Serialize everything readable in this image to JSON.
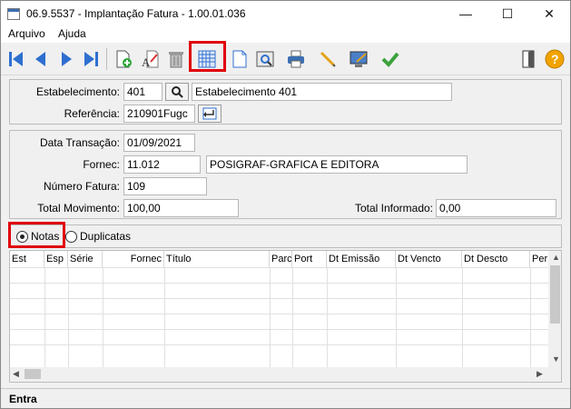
{
  "window": {
    "title": "06.9.5537 - Implantação Fatura - 1.00.01.036",
    "controls": {
      "minimize": "—",
      "maximize": "☐",
      "close": "✕"
    }
  },
  "menu": {
    "items": [
      "Arquivo",
      "Ajuda"
    ]
  },
  "toolbar": {
    "buttons": [
      "first-icon",
      "previous-icon",
      "next-icon",
      "last-icon",
      "new-icon",
      "edit-icon",
      "delete-icon",
      "calendar-grid-icon",
      "document-icon",
      "preview-icon",
      "print-icon",
      "pencil-icon",
      "tools-icon",
      "confirm-icon",
      "exit-icon",
      "help-icon"
    ],
    "highlight_color": "#e0000a"
  },
  "header_panel": {
    "estabelecimento_label": "Estabelecimento:",
    "estabelecimento_code": "401",
    "estabelecimento_name": "Estabelecimento 401",
    "referencia_label": "Referência:",
    "referencia_value": "210901Fugc"
  },
  "detail_panel": {
    "data_transacao_label": "Data Transação:",
    "data_transacao_value": "01/09/2021",
    "fornec_label": "Fornec:",
    "fornec_code": "11.012",
    "fornec_name": "POSIGRAF-GRAFICA E EDITORA",
    "numero_fatura_label": "Número  Fatura:",
    "numero_fatura_value": "109",
    "total_movimento_label": "Total  Movimento:",
    "total_movimento_value": "100,00",
    "total_informado_label": "Total Informado:",
    "total_informado_value": "0,00"
  },
  "options": {
    "notas_label": "Notas",
    "duplicatas_label": "Duplicatas",
    "selected": "Notas"
  },
  "grid": {
    "columns": [
      "Est",
      "Esp",
      "Série",
      "Fornec",
      "Título",
      "Parc",
      "Port",
      "Dt Emissão",
      "Dt Vencto",
      "Dt Descto",
      "Per"
    ],
    "rows": []
  },
  "status": {
    "text": "Entra"
  }
}
